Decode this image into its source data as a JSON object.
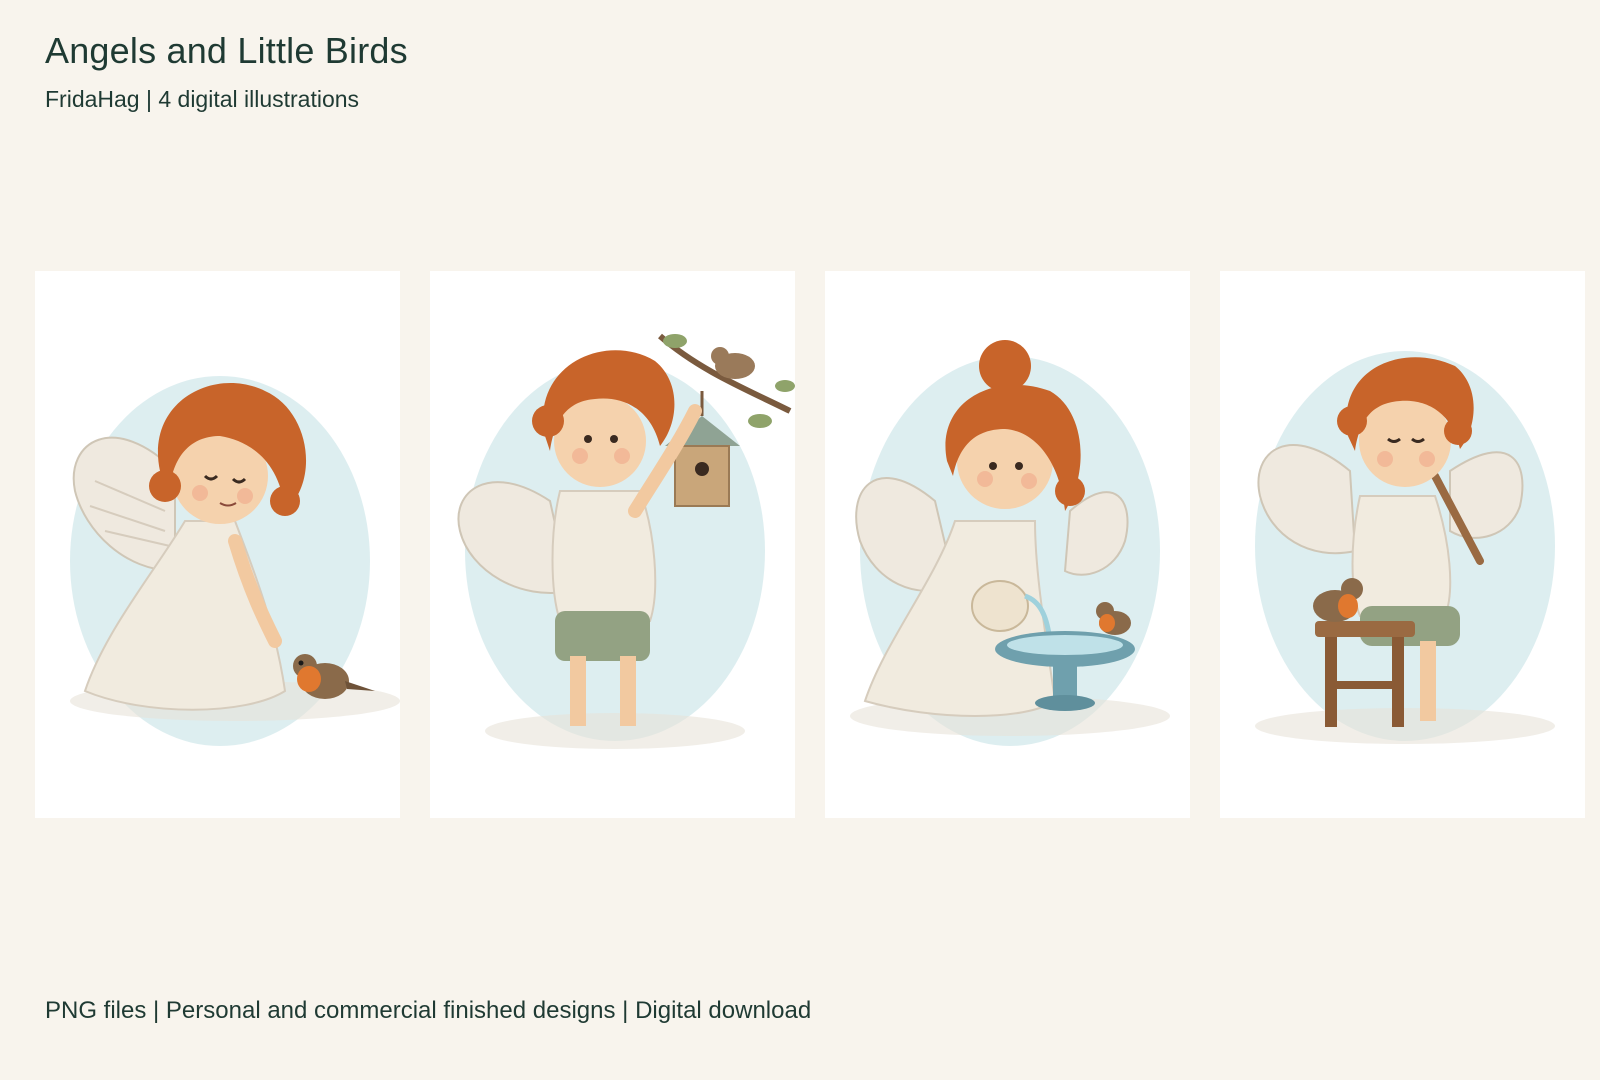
{
  "header": {
    "title": "Angels and Little Birds",
    "subtitle": "FridaHag | 4 digital illustrations"
  },
  "illustrations": [
    {
      "scene": "angel feeding a robin"
    },
    {
      "scene": "angel holding a birdhouse under a branch with a sparrow"
    },
    {
      "scene": "angel pouring water into a birdbath with a robin"
    },
    {
      "scene": "angel playing a flute on a stool with a robin"
    }
  ],
  "footer": {
    "text": "PNG files | Personal and commercial finished designs | Digital download"
  },
  "colors": {
    "background": "#f8f4ed",
    "text": "#1f3a33",
    "hair": "#c8642a",
    "wing": "#efe9df",
    "watercolor": "#cfe7ea",
    "robin_breast": "#e0782f"
  }
}
